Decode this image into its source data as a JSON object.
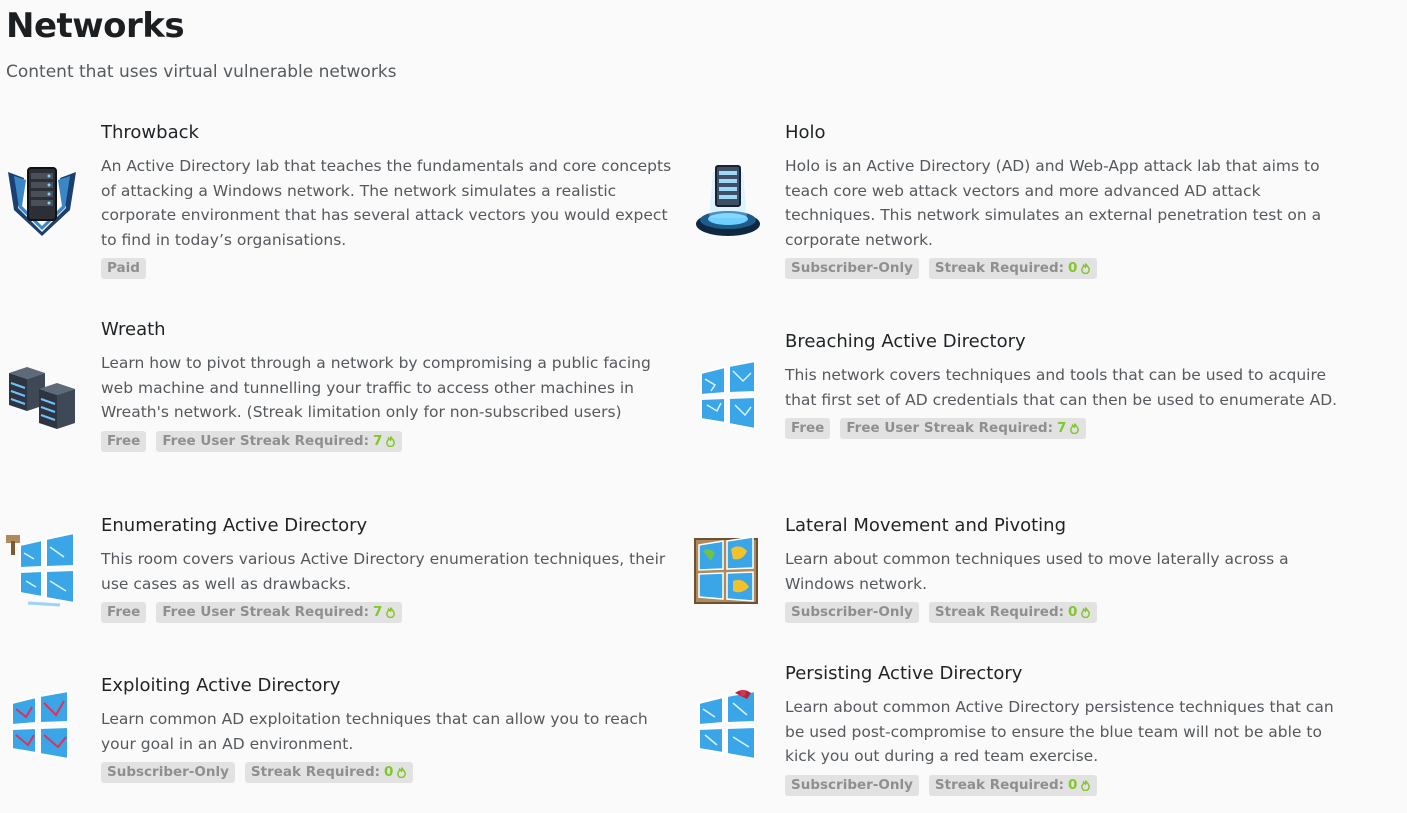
{
  "header": {
    "title": "Networks",
    "subtitle": "Content that uses virtual vulnerable networks"
  },
  "colors": {
    "accent_green": "#82c72a",
    "tag_bg": "#e2e2e2",
    "tag_text": "#8f8f8f"
  },
  "networks": [
    {
      "title": "Throwback",
      "description": "An Active Directory lab that teaches the fundamentals and core concepts of attacking a Windows network. The network simulates a realistic corporate environment that has several attack vectors you would expect to find in today’s organisations.",
      "icon": "server-shield-icon",
      "tags": [
        {
          "label": "Paid"
        }
      ]
    },
    {
      "title": "Holo",
      "description": "Holo is an Active Directory (AD) and Web-App attack lab that aims to teach core web attack vectors and more advanced AD attack techniques. This network simulates an external penetration test on a corporate network.",
      "icon": "hologram-server-icon",
      "tags": [
        {
          "label": "Subscriber-Only"
        },
        {
          "label": "Streak Required:",
          "value": "0"
        }
      ]
    },
    {
      "title": "Wreath",
      "description": "Learn how to pivot through a network by compromising a public facing web machine and tunnelling your traffic to access other machines in Wreath's network. (Streak limitation only for non-subscribed users)",
      "icon": "server-racks-icon",
      "tags": [
        {
          "label": "Free"
        },
        {
          "label": "Free User Streak Required:",
          "value": "7"
        }
      ]
    },
    {
      "title": "Breaching Active Directory",
      "description": "This network covers techniques and tools that can be used to acquire that first set of AD credentials that can then be used to enumerate AD.",
      "icon": "broken-windows-icon",
      "tags": [
        {
          "label": "Free"
        },
        {
          "label": "Free User Streak Required:",
          "value": "7"
        }
      ]
    },
    {
      "title": "Enumerating Active Directory",
      "description": "This room covers various Active Directory enumeration techniques, their use cases as well as drawbacks.",
      "icon": "windows-hammer-icon",
      "tags": [
        {
          "label": "Free"
        },
        {
          "label": "Free User Streak Required:",
          "value": "7"
        }
      ]
    },
    {
      "title": "Lateral Movement and Pivoting",
      "description": "Learn about common techniques used to move laterally across a Windows network.",
      "icon": "windows-map-icon",
      "tags": [
        {
          "label": "Subscriber-Only"
        },
        {
          "label": "Streak Required:",
          "value": "0"
        }
      ]
    },
    {
      "title": "Exploiting Active Directory",
      "description": "Learn common AD exploitation techniques that can allow you to reach your goal in an AD environment.",
      "icon": "windows-exploit-icon",
      "tags": [
        {
          "label": "Subscriber-Only"
        },
        {
          "label": "Streak Required:",
          "value": "0"
        }
      ]
    },
    {
      "title": "Persisting Active Directory",
      "description": "Learn about common Active Directory persistence techniques that can be used post-compromise to ensure the blue team will not be able to kick you out during a red team exercise.",
      "icon": "windows-persist-icon",
      "tags": [
        {
          "label": "Subscriber-Only"
        },
        {
          "label": "Streak Required:",
          "value": "0"
        }
      ]
    }
  ]
}
